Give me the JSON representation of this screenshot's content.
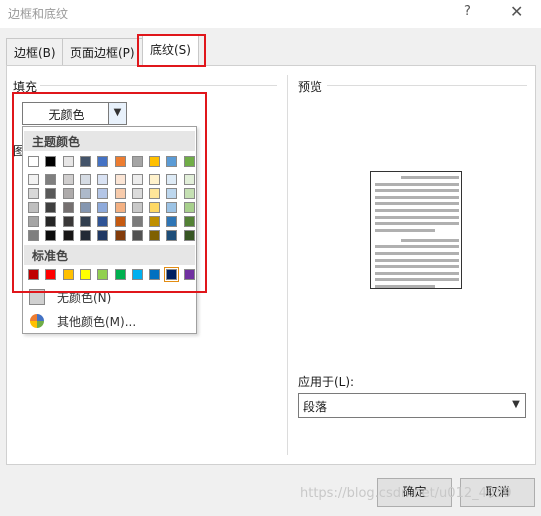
{
  "window": {
    "title": "边框和底纹",
    "help": "?",
    "close": "✕"
  },
  "tabs": [
    {
      "label": "边框(B)"
    },
    {
      "label": "页面边框(P)"
    },
    {
      "label": "底纹(S)"
    }
  ],
  "fill": {
    "label": "填充",
    "value": "无颜色",
    "pattern_label_clip": "图"
  },
  "palette": {
    "theme_title": "主题颜色",
    "standard_title": "标准色",
    "theme_top": [
      "#ffffff",
      "#000000",
      "#e7e6e6",
      "#44546a",
      "#4472c4",
      "#ed7d31",
      "#a5a5a5",
      "#ffc000",
      "#5b9bd5",
      "#70ad47"
    ],
    "theme_shades": [
      [
        "#f2f2f2",
        "#7f7f7f",
        "#d0cece",
        "#d6dce4",
        "#d9e2f3",
        "#fbe5d5",
        "#ededed",
        "#fff2cc",
        "#deebf6",
        "#e2efd9"
      ],
      [
        "#d8d8d8",
        "#595959",
        "#aeabab",
        "#adb9ca",
        "#b4c6e7",
        "#f7cbac",
        "#dbdbdb",
        "#fee599",
        "#bdd7ee",
        "#c5e0b3"
      ],
      [
        "#bfbfbf",
        "#3f3f3f",
        "#757070",
        "#8496b0",
        "#8eaadb",
        "#f4b183",
        "#c9c9c9",
        "#ffd965",
        "#9cc3e5",
        "#a8d08d"
      ],
      [
        "#a5a5a5",
        "#262626",
        "#3a3838",
        "#323f4f",
        "#2f5496",
        "#c55a11",
        "#7b7b7b",
        "#bf8f00",
        "#2e75b5",
        "#538135"
      ],
      [
        "#7f7f7f",
        "#0c0c0c",
        "#171616",
        "#222a35",
        "#1f3864",
        "#833c0b",
        "#525252",
        "#7f6000",
        "#1e4e79",
        "#375623"
      ]
    ],
    "standard": [
      "#c00000",
      "#ff0000",
      "#ffc000",
      "#ffff00",
      "#92d050",
      "#00b050",
      "#00b0f0",
      "#0070c0",
      "#002060",
      "#7030a0"
    ],
    "no_color_label": "无颜色(N)",
    "more_colors_label": "其他颜色(M)..."
  },
  "preview": {
    "label": "预览"
  },
  "apply": {
    "label": "应用于(L):",
    "value": "段落"
  },
  "buttons": {
    "ok": "确定",
    "cancel": "取消"
  },
  "watermark": "https://blog.csdn.net/u012_4039",
  "colors": {
    "highlight": "#e0161b",
    "selected_swatch": "#e38d13"
  }
}
